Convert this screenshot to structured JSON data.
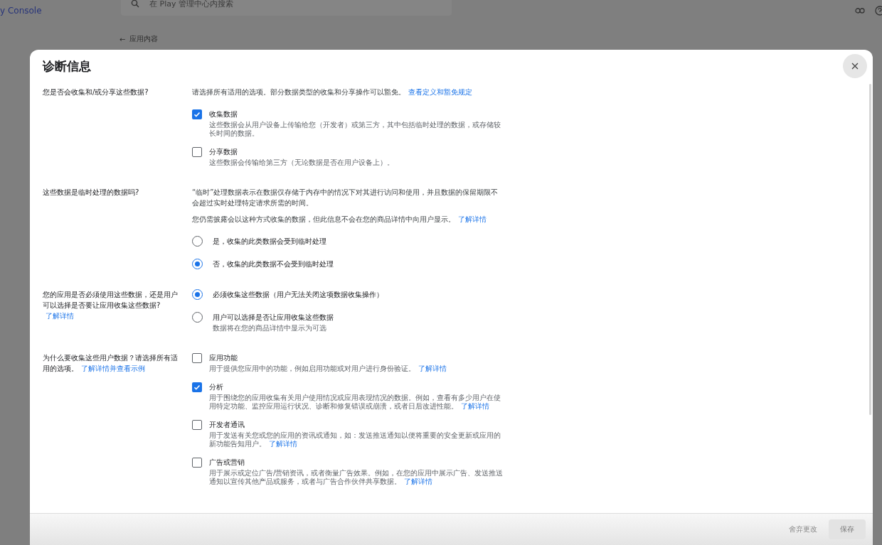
{
  "header": {
    "logo": "y Console",
    "search": {
      "placeholder": "在 Play 管理中心内搜索"
    }
  },
  "back_link": {
    "arrow": "←",
    "label": "应用内容"
  },
  "dialog": {
    "title": "诊断信息",
    "sections": [
      {
        "question": "您是否会收集和/或分享这些数据?",
        "intro": [
          {
            "text": "请选择所有适用的选项。部分数据类型的收集和分享操作可以豁免。",
            "link": "查看定义和豁免规定"
          }
        ],
        "options": [
          {
            "kind": "checkbox",
            "label": "收集数据",
            "description": "这些数据会从用户设备上传输给您（开发者）或第三方，其中包括临时处理的数据，或存储较长时间的数据。",
            "checked": true
          },
          {
            "kind": "checkbox",
            "label": "分享数据",
            "description": "这些数据会传输给第三方（无论数据是否在用户设备上）。",
            "checked": false
          }
        ]
      },
      {
        "question": "这些数据是临时处理的数据吗?",
        "intro": [
          {
            "text": "“临时”处理数据表示在数据仅存储于内存中的情况下对其进行访问和使用，并且数据的保留期限不会超过实时处理特定请求所需的时间。"
          },
          {
            "text": "您仍需披露会以这种方式收集的数据，但此信息不会在您的商品详情中向用户显示。",
            "link": "了解详情"
          }
        ],
        "options": [
          {
            "kind": "radio",
            "label": "是，收集的此类数据会受到临时处理",
            "selected": false
          },
          {
            "kind": "radio",
            "label": "否，收集的此类数据不会受到临时处理",
            "selected": true
          }
        ]
      },
      {
        "question": "您的应用是否必须使用这些数据，还是用户可以选择是否要让应用收集这些数据?",
        "question_link": "了解详情",
        "options": [
          {
            "kind": "radio",
            "label": "必须收集这些数据（用户无法关闭这项数据收集操作）",
            "selected": true
          },
          {
            "kind": "radio",
            "label": "用户可以选择是否让应用收集这些数据",
            "description": "数据将在您的商品详情中显示为可选",
            "selected": false
          }
        ]
      },
      {
        "question": "为什么要收集这些用户数据？请选择所有适用的选项。",
        "question_link": "了解详情并查看示例",
        "options": [
          {
            "kind": "checkbox",
            "label": "应用功能",
            "description": "用于提供您应用中的功能，例如启用功能或对用户进行身份验证。",
            "link": "了解详情",
            "checked": false
          },
          {
            "kind": "checkbox",
            "label": "分析",
            "description": "用于围绕您的应用收集有关用户使用情况或应用表现情况的数据。例如，查看有多少用户在使用特定功能、监控应用运行状况、诊断和修复错误或崩溃，或者日后改进性能。",
            "link": "了解详情",
            "checked": true
          },
          {
            "kind": "checkbox",
            "label": "开发者通讯",
            "description": "用于发送有关您或您的应用的资讯或通知，如：发送推送通知以便将重要的安全更新或应用的新功能告知用户。",
            "link": "了解详情",
            "checked": false
          },
          {
            "kind": "checkbox",
            "label": "广告或营销",
            "description": "用于展示或定位广告/营销资讯，或者衡量广告效果。例如，在您的应用中展示广告、发送推送通知以宣传其他产品或服务，或者与广告合作伙伴共享数据。",
            "link": "了解详情",
            "checked": false
          }
        ]
      }
    ],
    "footer": {
      "discard": {
        "label": "舍弃更改",
        "disabled": true
      },
      "save": {
        "label": "保存",
        "disabled": true
      }
    }
  }
}
